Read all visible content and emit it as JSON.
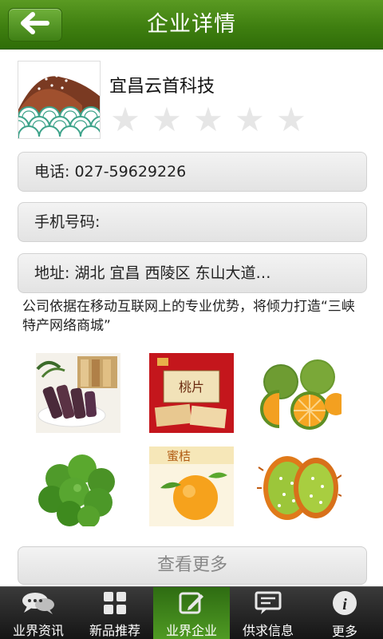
{
  "header": {
    "title": "企业详情",
    "back_icon": "back-arrow-icon"
  },
  "company": {
    "name": "宜昌云首科技",
    "rating": 0,
    "rating_max": 5,
    "phone": "电话: 027-59629226",
    "mobile": "手机号码:",
    "address": "地址: 湖北 宜昌 西陵区 东山大道…",
    "description": "公司依据在移动互联网上的专业优势，将倾力打造“三峡特产网络商城”"
  },
  "more_button": {
    "label": "查看更多"
  },
  "tabbar": {
    "items": [
      {
        "label": "业界资讯",
        "icon": "chat-bubbles-icon"
      },
      {
        "label": "新品推荐",
        "icon": "grid-icon"
      },
      {
        "label": "业界企业",
        "icon": "edit-icon",
        "active": true
      },
      {
        "label": "供求信息",
        "icon": "message-icon"
      },
      {
        "label": "更多",
        "icon": "info-icon"
      }
    ]
  },
  "colors": {
    "header_green": "#3f7f10",
    "tab_active": "#3c8518",
    "star_empty": "#e6e6e6"
  }
}
